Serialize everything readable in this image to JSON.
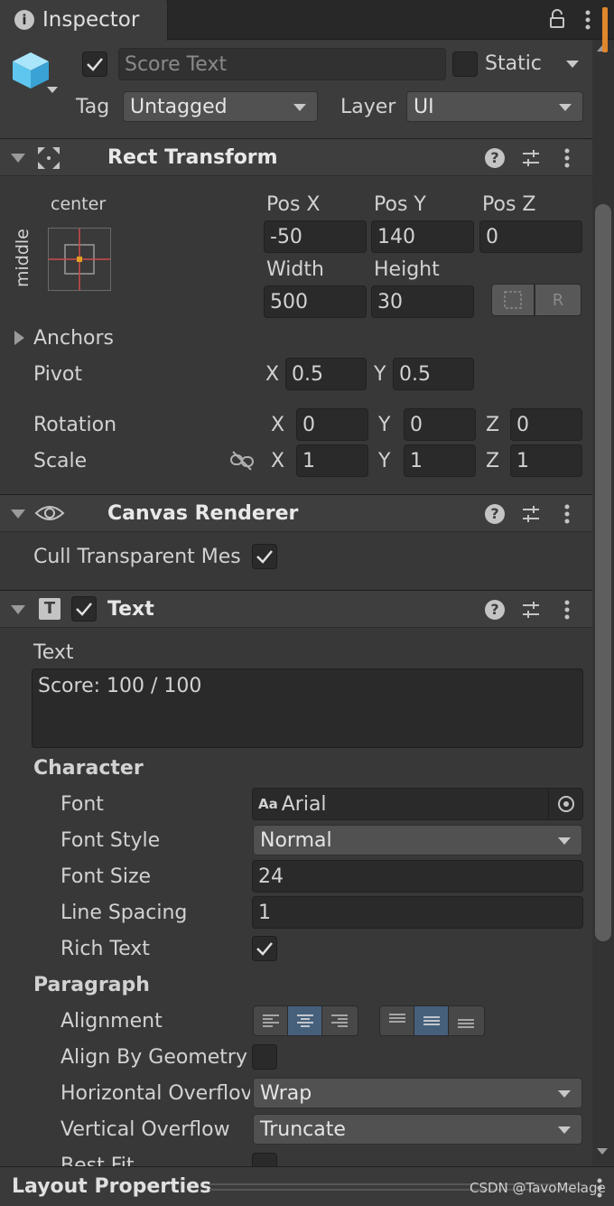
{
  "tab": {
    "title": "Inspector"
  },
  "object": {
    "name": "Score Text",
    "static_label": "Static",
    "tag_label": "Tag",
    "tag_value": "Untagged",
    "layer_label": "Layer",
    "layer_value": "UI"
  },
  "rect_transform": {
    "title": "Rect Transform",
    "anchor_h": "center",
    "anchor_v": "middle",
    "posx_label": "Pos X",
    "posy_label": "Pos Y",
    "posz_label": "Pos Z",
    "posx": "-50",
    "posy": "140",
    "posz": "0",
    "width_label": "Width",
    "height_label": "Height",
    "width": "500",
    "height": "30",
    "raw_button": "R",
    "anchors_label": "Anchors",
    "pivot_label": "Pivot",
    "pivot_x": "0.5",
    "pivot_y": "0.5",
    "rotation_label": "Rotation",
    "rot_x": "0",
    "rot_y": "0",
    "rot_z": "0",
    "scale_label": "Scale",
    "scale_x": "1",
    "scale_y": "1",
    "scale_z": "1",
    "axis_x": "X",
    "axis_y": "Y",
    "axis_z": "Z"
  },
  "canvas_renderer": {
    "title": "Canvas Renderer",
    "cull_label": "Cull Transparent Mes"
  },
  "text_component": {
    "title": "Text",
    "text_label": "Text",
    "text_value": "Score: 100 / 100",
    "character_label": "Character",
    "font_label": "Font",
    "font_icon_text": "Aa",
    "font_value": "Arial",
    "font_style_label": "Font Style",
    "font_style_value": "Normal",
    "font_size_label": "Font Size",
    "font_size_value": "24",
    "line_spacing_label": "Line Spacing",
    "line_spacing_value": "1",
    "rich_text_label": "Rich Text",
    "paragraph_label": "Paragraph",
    "alignment_label": "Alignment",
    "align_geometry_label": "Align By Geometry",
    "h_overflow_label": "Horizontal Overflov",
    "h_overflow_value": "Wrap",
    "v_overflow_label": "Vertical Overflow",
    "v_overflow_value": "Truncate",
    "best_fit_label": "Best Fit"
  },
  "footer": {
    "title": "Layout Properties",
    "watermark": "CSDN @TavoMelage"
  },
  "colors": {
    "background": "#383838",
    "accent_scrollbar": "#e0862c",
    "selected_button": "#46607c",
    "cube_icon": "#5fc7ef"
  }
}
